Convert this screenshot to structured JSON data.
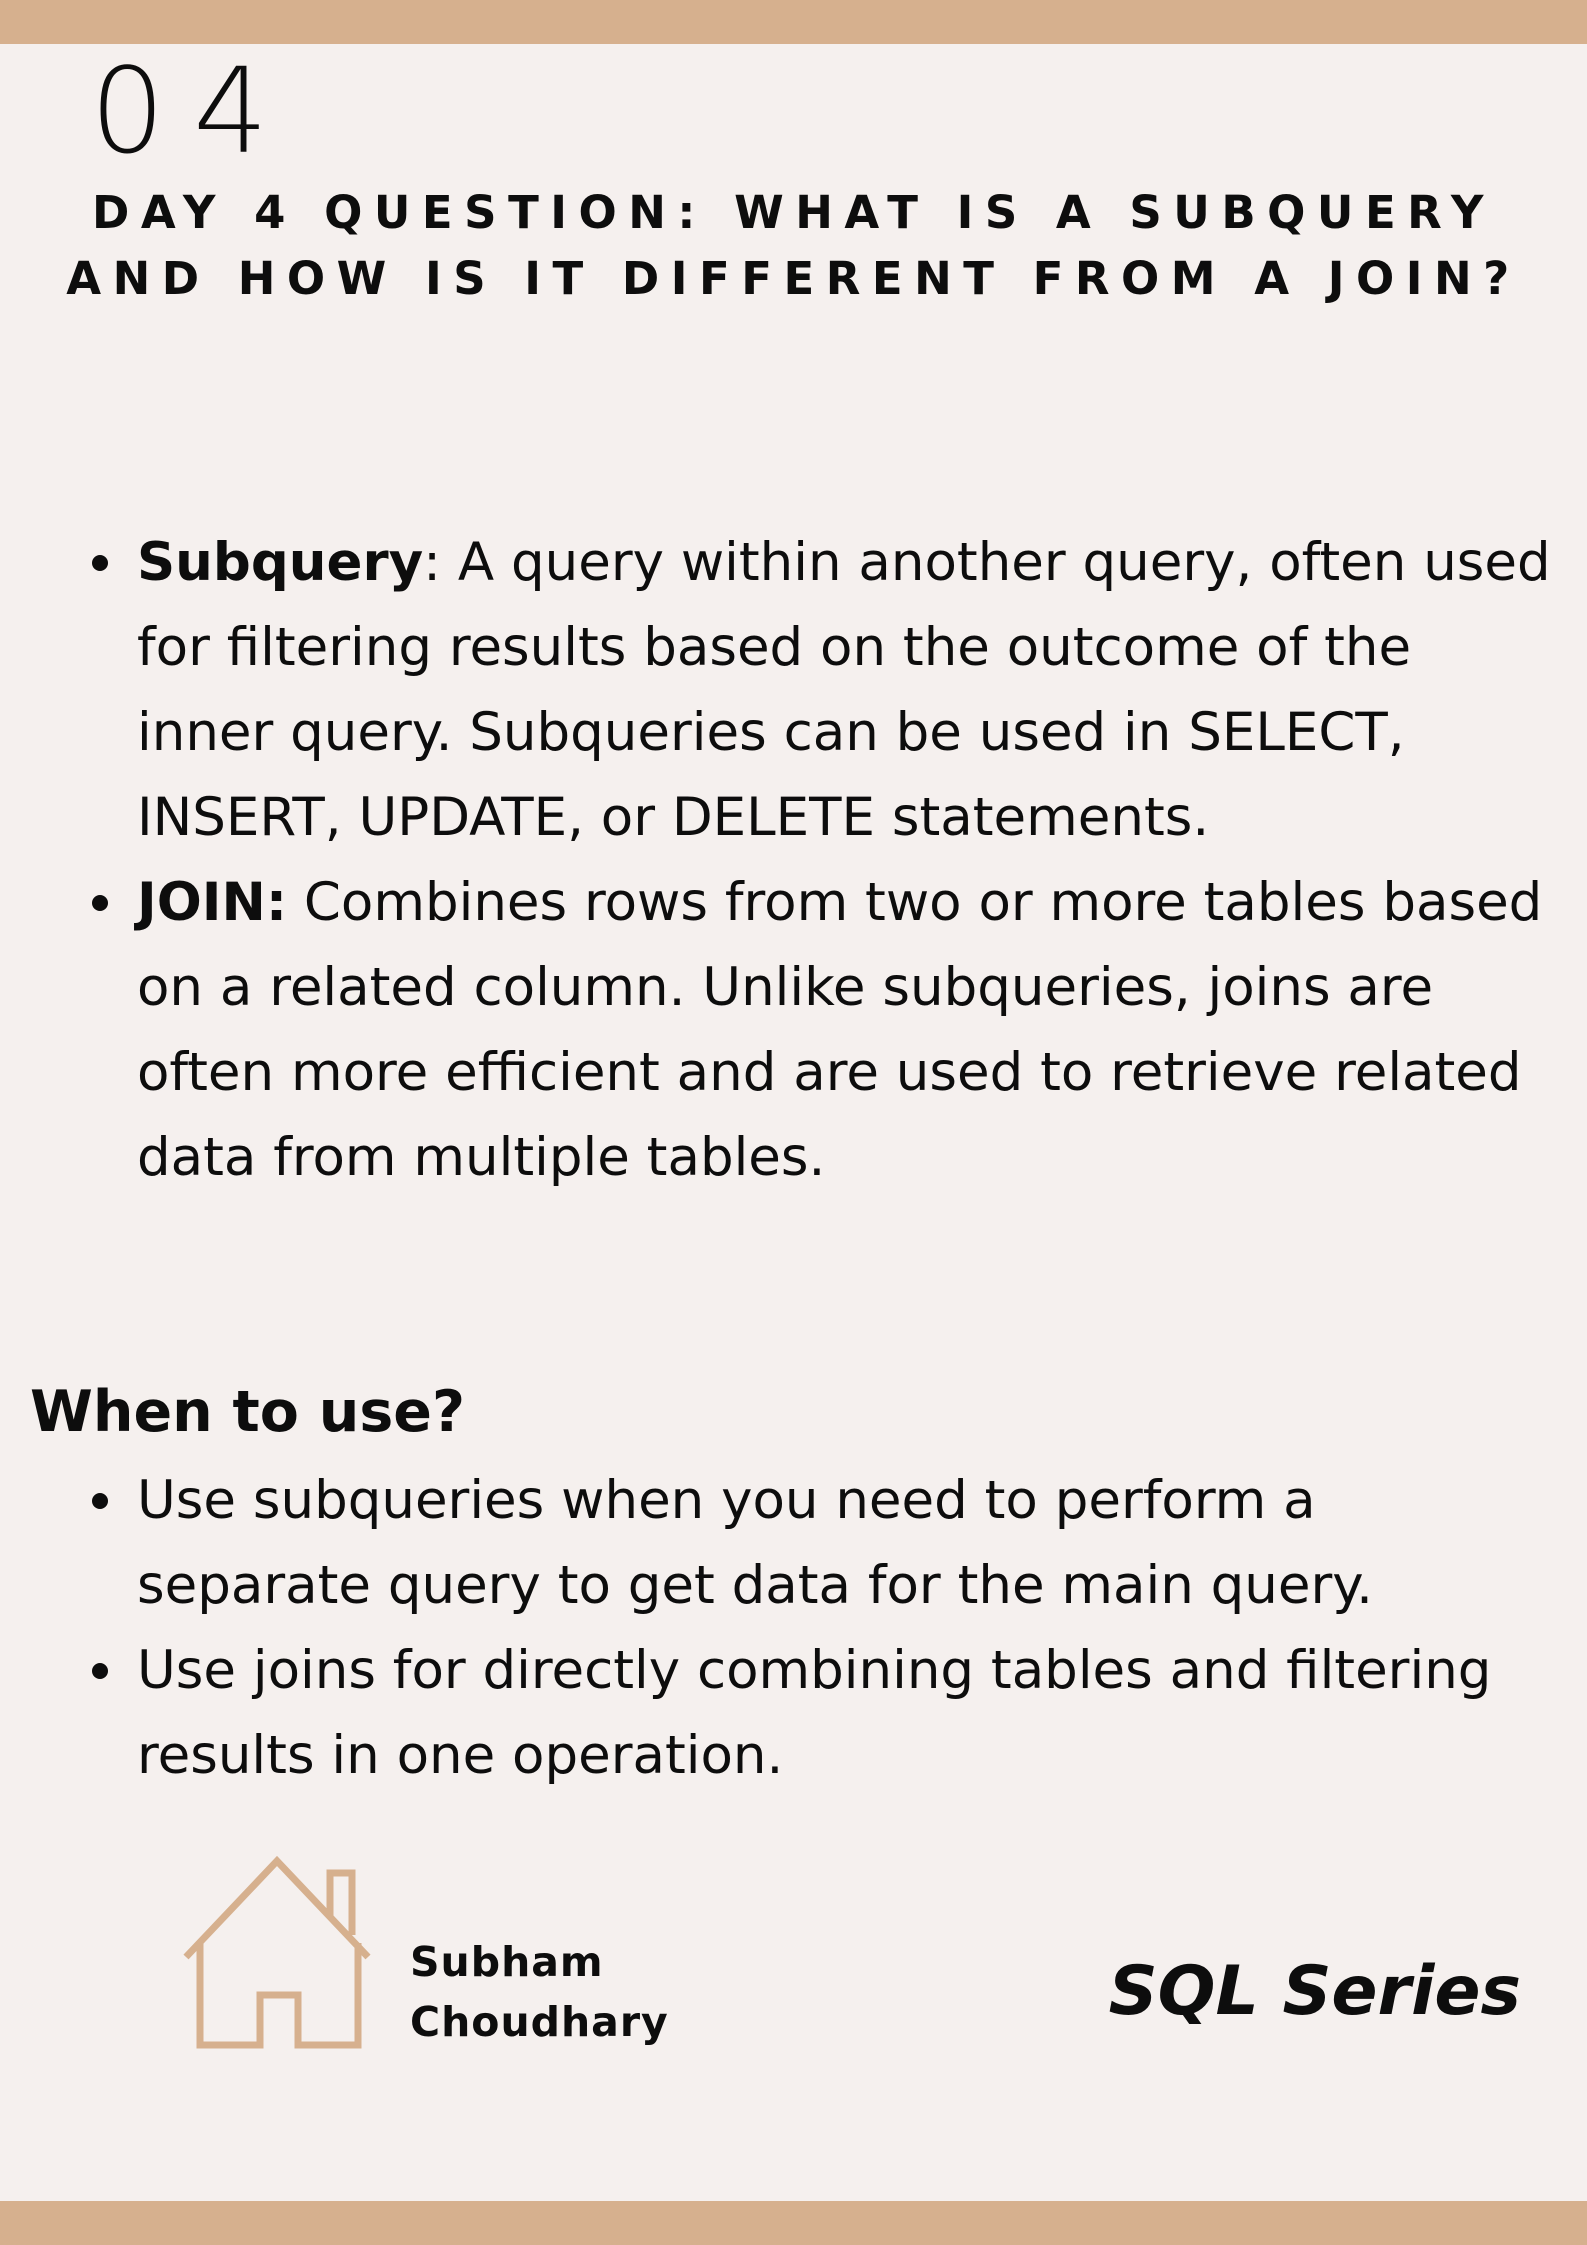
{
  "slide": {
    "number": "04",
    "question": "DAY 4 QUESTION: WHAT IS A SUBQUERY AND HOW IS IT DIFFERENT FROM A JOIN?"
  },
  "definitions": [
    {
      "term": "Subquery",
      "separator": ": ",
      "text": "A query within another query, often used for filtering results based on the outcome of the inner query. Subqueries can be used in SELECT, INSERT, UPDATE, or DELETE statements."
    },
    {
      "term": "JOIN:",
      "separator": " ",
      "text": "Combines rows from two or more tables based on a related column. Unlike subqueries, joins are often more efficient and are used to retrieve related data from multiple tables."
    }
  ],
  "when_to_use": {
    "heading": "When to use?",
    "items": [
      "Use subqueries when you need to perform a separate query to get data for the main query.",
      "Use joins for directly combining tables and filtering results in one operation."
    ]
  },
  "footer": {
    "author_first": "Subham",
    "author_last": "Choudhary",
    "series": "SQL Series",
    "icon": "house-icon"
  },
  "colors": {
    "band": "#d6b08e",
    "background": "#f5f0ee",
    "text": "#0d0d0d",
    "icon_stroke": "#d6b08e"
  }
}
